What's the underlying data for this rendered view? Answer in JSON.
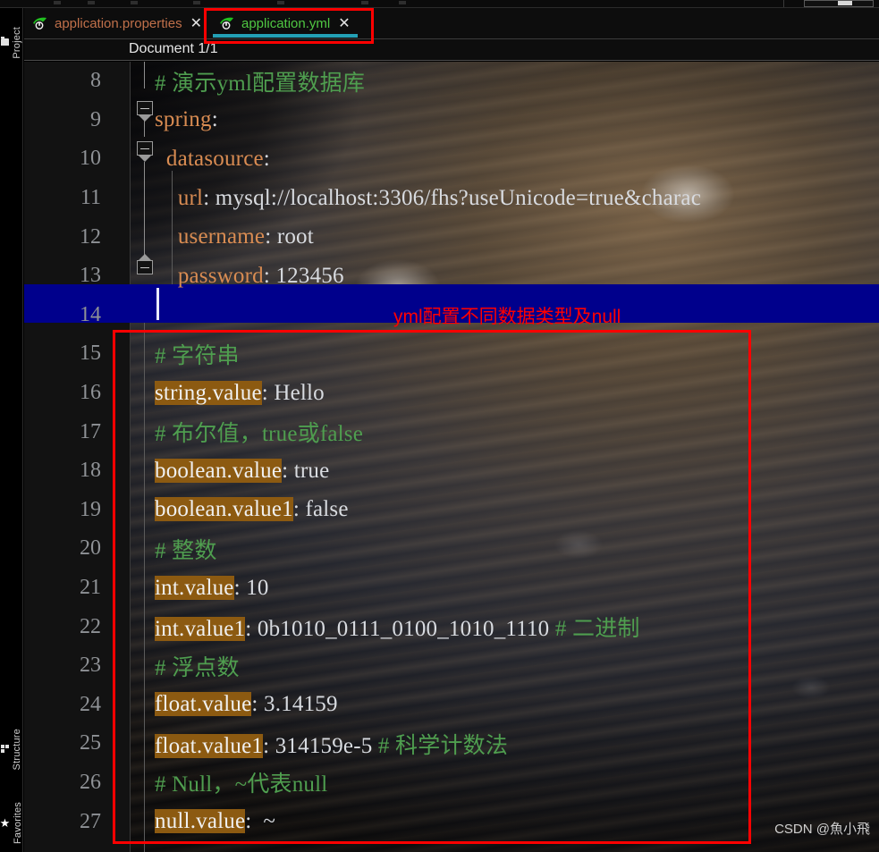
{
  "window": {
    "title": "application.yml"
  },
  "toolstrip": {
    "buttons": [
      {
        "label": "Project",
        "icon": "folder-icon"
      },
      {
        "label": "Structure",
        "icon": "structure-icon"
      },
      {
        "label": "Favorites",
        "icon": "star-icon"
      }
    ]
  },
  "tabs": [
    {
      "label": "application.properties",
      "icon": "spring-leaf-icon",
      "close": "✕",
      "active": false
    },
    {
      "label": "application.yml",
      "icon": "spring-leaf-icon",
      "close": "✕",
      "active": true
    }
  ],
  "breadcrumb": {
    "text": "Document 1/1"
  },
  "editor": {
    "language": "yaml",
    "caret_line": 14,
    "lines": [
      {
        "number": "8",
        "tokens": [
          {
            "text": "# 演示yml配置数据库",
            "type": "comment"
          }
        ]
      },
      {
        "number": "9",
        "fold": "collapse-down",
        "tokens": [
          {
            "text": "spring",
            "type": "key"
          },
          {
            "text": ":",
            "type": "punct"
          }
        ]
      },
      {
        "number": "10",
        "fold": "collapse-down",
        "tokens": [
          {
            "text": "  ",
            "type": "punct"
          },
          {
            "text": "datasource",
            "type": "key"
          },
          {
            "text": ":",
            "type": "punct"
          }
        ]
      },
      {
        "number": "11",
        "tokens": [
          {
            "text": "    ",
            "type": "punct"
          },
          {
            "text": "url",
            "type": "key"
          },
          {
            "text": ": ",
            "type": "punct"
          },
          {
            "text": "mysql://localhost:3306/fhs?useUnicode=true&charac",
            "type": "value"
          }
        ]
      },
      {
        "number": "12",
        "tokens": [
          {
            "text": "    ",
            "type": "punct"
          },
          {
            "text": "username",
            "type": "key"
          },
          {
            "text": ": ",
            "type": "punct"
          },
          {
            "text": "root",
            "type": "value"
          }
        ]
      },
      {
        "number": "13",
        "fold": "collapse-up",
        "tokens": [
          {
            "text": "    ",
            "type": "punct"
          },
          {
            "text": "password",
            "type": "key"
          },
          {
            "text": ": ",
            "type": "punct"
          },
          {
            "text": "123456",
            "type": "value"
          }
        ]
      },
      {
        "number": "14",
        "selected": true,
        "tokens": []
      },
      {
        "number": "15",
        "tokens": [
          {
            "text": "# 字符串",
            "type": "comment"
          }
        ]
      },
      {
        "number": "16",
        "tokens": [
          {
            "text": "string.value",
            "type": "key-highlight"
          },
          {
            "text": ": ",
            "type": "punct"
          },
          {
            "text": "Hello",
            "type": "value"
          }
        ]
      },
      {
        "number": "17",
        "tokens": [
          {
            "text": "# 布尔值，true或false",
            "type": "comment"
          }
        ]
      },
      {
        "number": "18",
        "tokens": [
          {
            "text": "boolean.value",
            "type": "key-highlight"
          },
          {
            "text": ": ",
            "type": "punct"
          },
          {
            "text": "true",
            "type": "value"
          }
        ]
      },
      {
        "number": "19",
        "tokens": [
          {
            "text": "boolean.value1",
            "type": "key-highlight"
          },
          {
            "text": ": ",
            "type": "punct"
          },
          {
            "text": "false",
            "type": "value"
          }
        ]
      },
      {
        "number": "20",
        "tokens": [
          {
            "text": "# 整数",
            "type": "comment"
          }
        ]
      },
      {
        "number": "21",
        "tokens": [
          {
            "text": "int.value",
            "type": "key-highlight"
          },
          {
            "text": ": ",
            "type": "punct"
          },
          {
            "text": "10",
            "type": "value"
          }
        ]
      },
      {
        "number": "22",
        "tokens": [
          {
            "text": "int.value1",
            "type": "key-highlight"
          },
          {
            "text": ": ",
            "type": "punct"
          },
          {
            "text": "0b1010_0111_0100_1010_1110",
            "type": "value"
          },
          {
            "text": " ",
            "type": "punct"
          },
          {
            "text": "# 二进制",
            "type": "comment"
          }
        ]
      },
      {
        "number": "23",
        "tokens": [
          {
            "text": "# 浮点数",
            "type": "comment"
          }
        ]
      },
      {
        "number": "24",
        "tokens": [
          {
            "text": "float.value",
            "type": "key-highlight"
          },
          {
            "text": ": ",
            "type": "punct"
          },
          {
            "text": "3.14159",
            "type": "value"
          }
        ]
      },
      {
        "number": "25",
        "tokens": [
          {
            "text": "float.value1",
            "type": "key-highlight"
          },
          {
            "text": ": ",
            "type": "punct"
          },
          {
            "text": "314159e-5",
            "type": "value"
          },
          {
            "text": " ",
            "type": "punct"
          },
          {
            "text": "# 科学计数法",
            "type": "comment"
          }
        ]
      },
      {
        "number": "26",
        "tokens": [
          {
            "text": "# Null，~代表null",
            "type": "comment"
          }
        ]
      },
      {
        "number": "27",
        "tokens": [
          {
            "text": "null.value",
            "type": "key-highlight"
          },
          {
            "text": ":  ",
            "type": "punct"
          },
          {
            "text": "~",
            "type": "value"
          }
        ]
      }
    ]
  },
  "annotations": {
    "tab_box_label": "",
    "line14_note": "yml配置不同数据类型及null",
    "code_box_label": ""
  },
  "watermark": {
    "text": "CSDN @魚小飛"
  },
  "colors": {
    "accent_tab_underline": "#23a0b5",
    "active_tab_text": "#4fc742",
    "inactive_tab_text": "#c0704a",
    "key": "#d98c52",
    "key_highlight_bg": "#8c5a11",
    "comment": "#4f9e4f",
    "value": "#d8dbe0",
    "selection_bg": "#00008c",
    "annotation_red": "#ff0000",
    "line_number": "#8f9296"
  }
}
